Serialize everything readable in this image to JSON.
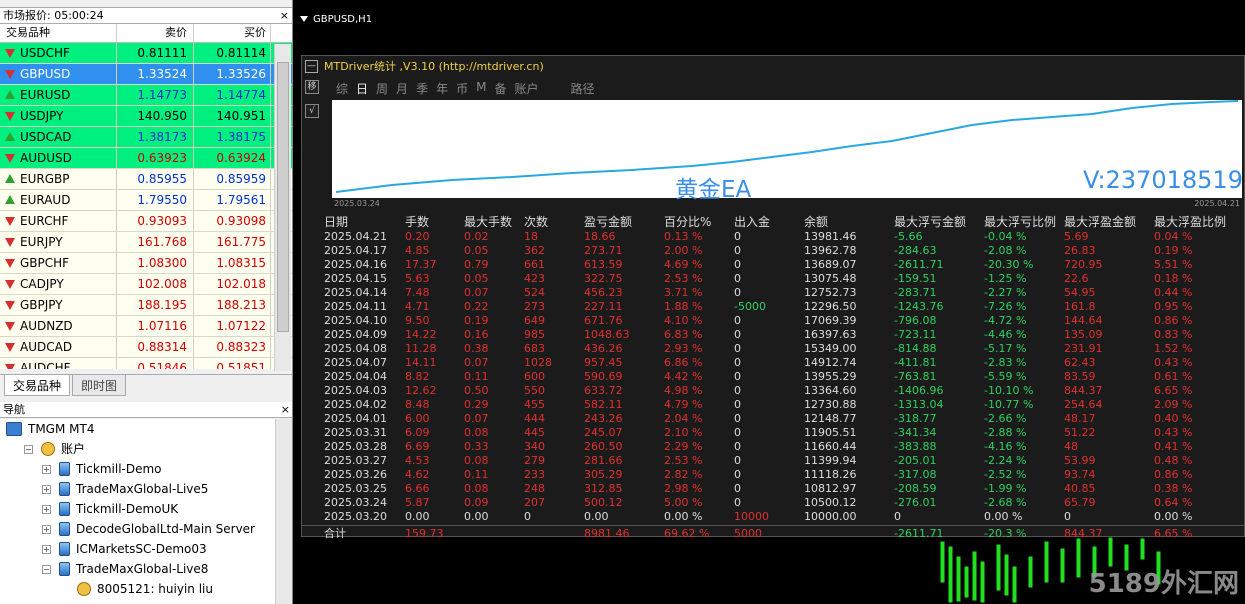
{
  "market_watch": {
    "title": "市场报价: 05:00:24",
    "columns": [
      "交易品种",
      "卖价",
      "买价"
    ],
    "rows": [
      {
        "symbol": "USDCHF",
        "bid": "0.81111",
        "ask": "0.81114",
        "dir": "down",
        "bg": "#00f080",
        "color": "#000"
      },
      {
        "symbol": "GBPUSD",
        "bid": "1.33524",
        "ask": "1.33526",
        "dir": "down",
        "bg": "#3090f0",
        "color": "#fff"
      },
      {
        "symbol": "EURUSD",
        "bid": "1.14773",
        "ask": "1.14774",
        "dir": "up",
        "bg": "#00f080",
        "color": "#0030d0"
      },
      {
        "symbol": "USDJPY",
        "bid": "140.950",
        "ask": "140.951",
        "dir": "down",
        "bg": "#00f080",
        "color": "#000"
      },
      {
        "symbol": "USDCAD",
        "bid": "1.38173",
        "ask": "1.38175",
        "dir": "up",
        "bg": "#00f080",
        "color": "#0030d0"
      },
      {
        "symbol": "AUDUSD",
        "bid": "0.63923",
        "ask": "0.63924",
        "dir": "down",
        "bg": "#00f080",
        "color": "#d00000"
      },
      {
        "symbol": "EURGBP",
        "bid": "0.85955",
        "ask": "0.85959",
        "dir": "up",
        "bg": "#fffff0",
        "color": "#0030d0"
      },
      {
        "symbol": "EURAUD",
        "bid": "1.79550",
        "ask": "1.79561",
        "dir": "up",
        "bg": "#fffff0",
        "color": "#0030d0"
      },
      {
        "symbol": "EURCHF",
        "bid": "0.93093",
        "ask": "0.93098",
        "dir": "down",
        "bg": "#fffff0",
        "color": "#d00000"
      },
      {
        "symbol": "EURJPY",
        "bid": "161.768",
        "ask": "161.775",
        "dir": "down",
        "bg": "#fffff0",
        "color": "#d00000"
      },
      {
        "symbol": "GBPCHF",
        "bid": "1.08300",
        "ask": "1.08315",
        "dir": "down",
        "bg": "#fffff0",
        "color": "#d00000"
      },
      {
        "symbol": "CADJPY",
        "bid": "102.008",
        "ask": "102.018",
        "dir": "down",
        "bg": "#fffff0",
        "color": "#d00000"
      },
      {
        "symbol": "GBPJPY",
        "bid": "188.195",
        "ask": "188.213",
        "dir": "down",
        "bg": "#fffff0",
        "color": "#d00000"
      },
      {
        "symbol": "AUDNZD",
        "bid": "1.07116",
        "ask": "1.07122",
        "dir": "down",
        "bg": "#fffff0",
        "color": "#d00000"
      },
      {
        "symbol": "AUDCAD",
        "bid": "0.88314",
        "ask": "0.88323",
        "dir": "down",
        "bg": "#fffff0",
        "color": "#d00000"
      },
      {
        "symbol": "AUDCHF",
        "bid": "0.51846",
        "ask": "0.51851",
        "dir": "down",
        "bg": "#fffff0",
        "color": "#d00000"
      }
    ],
    "tabs": [
      "交易品种",
      "即时图"
    ]
  },
  "navigator": {
    "title": "导航",
    "items": [
      {
        "label": "TMGM MT4",
        "icon": "root",
        "level": 0
      },
      {
        "label": "账户",
        "icon": "users",
        "level": 1
      },
      {
        "label": "Tickmill-Demo",
        "icon": "srv",
        "level": 2
      },
      {
        "label": "TradeMaxGlobal-Live5",
        "icon": "srv",
        "level": 2
      },
      {
        "label": "Tickmill-DemoUK",
        "icon": "srv",
        "level": 2
      },
      {
        "label": "DecodeGlobalLtd-Main Server",
        "icon": "srv",
        "level": 2
      },
      {
        "label": "ICMarketsSC-Demo03",
        "icon": "srv",
        "level": 2
      },
      {
        "label": "TradeMaxGlobal-Live8",
        "icon": "srv",
        "level": 2,
        "open": true
      },
      {
        "label": "8005121: huiyin liu",
        "icon": "user",
        "level": 3
      }
    ]
  },
  "chart": {
    "title": "GBPUSD,H1"
  },
  "indicator": {
    "title": "MTDriver统计 ,V3.10 (http://mtdriver.cn)",
    "tabs": [
      "综",
      "日",
      "周",
      "月",
      "季",
      "年",
      "币",
      "M",
      "备",
      "账户",
      "路径"
    ],
    "side_buttons": [
      "移",
      "√"
    ],
    "date_start": "2025.03.24",
    "date_end": "2025.04.21",
    "watermark_left": "黄金EA",
    "watermark_right": "V:237018519",
    "columns": [
      "日期",
      "手数",
      "最大手数",
      "次数",
      "盈亏金额",
      "百分比%",
      "出入金",
      "余额",
      "最大浮亏金额",
      "最大浮亏比例",
      "最大浮盈金额",
      "最大浮盈比例"
    ],
    "rows": [
      [
        "2025.04.21",
        "0.20",
        "0.02",
        "18",
        "18.66",
        "0.13 %",
        "0",
        "13981.46",
        "-5.66",
        "-0.04 %",
        "5.69",
        "0.04 %"
      ],
      [
        "2025.04.17",
        "4.85",
        "0.05",
        "362",
        "273.71",
        "2.00 %",
        "0",
        "13962.78",
        "-284.63",
        "-2.08 %",
        "26.83",
        "0.19 %"
      ],
      [
        "2025.04.16",
        "17.37",
        "0.79",
        "661",
        "613.59",
        "4.69 %",
        "0",
        "13689.07",
        "-2611.71",
        "-20.30 %",
        "720.95",
        "5.51 %"
      ],
      [
        "2025.04.15",
        "5.63",
        "0.05",
        "423",
        "322.75",
        "2.53 %",
        "0",
        "13075.48",
        "-159.51",
        "-1.25 %",
        "22.6",
        "0.18 %"
      ],
      [
        "2025.04.14",
        "7.48",
        "0.07",
        "524",
        "456.23",
        "3.71 %",
        "0",
        "12752.73",
        "-283.71",
        "-2.27 %",
        "54.95",
        "0.44 %"
      ],
      [
        "2025.04.11",
        "4.71",
        "0.22",
        "273",
        "227.11",
        "1.88 %",
        "-5000",
        "12296.50",
        "-1243.76",
        "-7.26 %",
        "161.8",
        "0.95 %"
      ],
      [
        "2025.04.10",
        "9.50",
        "0.19",
        "649",
        "671.76",
        "4.10 %",
        "0",
        "17069.39",
        "-796.08",
        "-4.72 %",
        "144.64",
        "0.86 %"
      ],
      [
        "2025.04.09",
        "14.22",
        "0.16",
        "985",
        "1048.63",
        "6.83 %",
        "0",
        "16397.63",
        "-723.11",
        "-4.46 %",
        "135.09",
        "0.83 %"
      ],
      [
        "2025.04.08",
        "11.28",
        "0.38",
        "683",
        "436.26",
        "2.93 %",
        "0",
        "15349.00",
        "-814.88",
        "-5.17 %",
        "231.91",
        "1.52 %"
      ],
      [
        "2025.04.07",
        "14.11",
        "0.07",
        "1028",
        "957.45",
        "6.86 %",
        "0",
        "14912.74",
        "-411.81",
        "-2.83 %",
        "62.43",
        "0.43 %"
      ],
      [
        "2025.04.04",
        "8.82",
        "0.11",
        "600",
        "590.69",
        "4.42 %",
        "0",
        "13955.29",
        "-763.81",
        "-5.59 %",
        "83.59",
        "0.61 %"
      ],
      [
        "2025.04.03",
        "12.62",
        "0.50",
        "550",
        "633.72",
        "4.98 %",
        "0",
        "13364.60",
        "-1406.96",
        "-10.10 %",
        "844.37",
        "6.65 %"
      ],
      [
        "2025.04.02",
        "8.48",
        "0.29",
        "455",
        "582.11",
        "4.79 %",
        "0",
        "12730.88",
        "-1313.04",
        "-10.77 %",
        "254.64",
        "2.09 %"
      ],
      [
        "2025.04.01",
        "6.00",
        "0.07",
        "444",
        "243.26",
        "2.04 %",
        "0",
        "12148.77",
        "-318.77",
        "-2.66 %",
        "48.17",
        "0.40 %"
      ],
      [
        "2025.03.31",
        "6.09",
        "0.08",
        "445",
        "245.07",
        "2.10 %",
        "0",
        "11905.51",
        "-341.34",
        "-2.88 %",
        "51.22",
        "0.43 %"
      ],
      [
        "2025.03.28",
        "6.69",
        "0.33",
        "340",
        "260.50",
        "2.29 %",
        "0",
        "11660.44",
        "-383.88",
        "-4.16 %",
        "48",
        "0.41 %"
      ],
      [
        "2025.03.27",
        "4.53",
        "0.08",
        "279",
        "281.66",
        "2.53 %",
        "0",
        "11399.94",
        "-205.01",
        "-2.24 %",
        "53.99",
        "0.48 %"
      ],
      [
        "2025.03.26",
        "4.62",
        "0.11",
        "233",
        "305.29",
        "2.82 %",
        "0",
        "11118.26",
        "-317.08",
        "-2.52 %",
        "93.74",
        "0.86 %"
      ],
      [
        "2025.03.25",
        "6.66",
        "0.08",
        "248",
        "312.85",
        "2.98 %",
        "0",
        "10812.97",
        "-208.59",
        "-1.99 %",
        "40.85",
        "0.38 %"
      ],
      [
        "2025.03.24",
        "5.87",
        "0.09",
        "207",
        "500.12",
        "5.00 %",
        "0",
        "10500.12",
        "-276.01",
        "-2.68 %",
        "65.79",
        "0.64 %"
      ],
      [
        "2025.03.20",
        "0.00",
        "0.00",
        "0",
        "0.00",
        "0.00 %",
        "10000",
        "10000.00",
        "0",
        "0.00 %",
        "0",
        "0.00 %"
      ]
    ],
    "totals": [
      "合计",
      "159.73",
      "",
      "",
      "8981.46",
      "69.62 %",
      "5000",
      "",
      "-2611.71",
      "-20.3 %",
      "844.37",
      "6.65 %"
    ]
  },
  "brand": "5189外汇网",
  "colors": {
    "accent_blue": "#3b8ee8",
    "loss_red": "#e03030",
    "gain_green": "#2fd060",
    "title_yellow": "#f0d04a"
  }
}
